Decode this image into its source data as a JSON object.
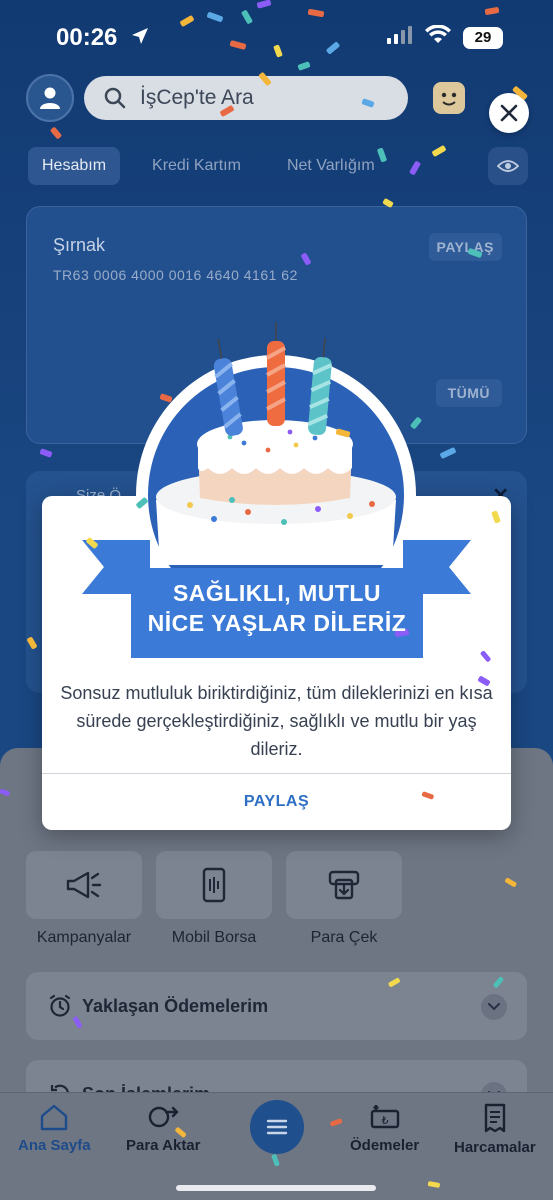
{
  "status": {
    "time": "00:26",
    "battery": "29"
  },
  "header": {
    "search_placeholder": "İşCep'te Ara"
  },
  "tabs": [
    {
      "label": "Hesabım",
      "active": true
    },
    {
      "label": "Kredi Kartım",
      "active": false
    },
    {
      "label": "Net Varlığım",
      "active": false
    }
  ],
  "account": {
    "name": "Şırnak",
    "iban": "TR63 0006 4000 0016 4640 4161 62",
    "share_label": "PAYLAŞ",
    "all_label": "TÜMÜ"
  },
  "second_card": {
    "title": "Size Ö..."
  },
  "quick_actions": [
    {
      "label": "Kampanyalar",
      "icon": "megaphone-icon"
    },
    {
      "label": "Mobil Borsa",
      "icon": "phone-chart-icon"
    },
    {
      "label": "Para Çek",
      "icon": "cash-withdraw-icon"
    }
  ],
  "rows": [
    {
      "label": "Yaklaşan Ödemelerim",
      "icon": "alarm-clock-icon"
    },
    {
      "label": "Son İşlemlerim",
      "icon": "history-icon"
    }
  ],
  "tab_bar": [
    {
      "label": "Ana Sayfa",
      "icon": "home-icon",
      "active": true
    },
    {
      "label": "Para Aktar",
      "icon": "transfer-icon",
      "active": false
    },
    {
      "label": "Ödemeler",
      "icon": "payment-icon",
      "active": false
    },
    {
      "label": "Harcamalar",
      "icon": "receipt-icon",
      "active": false
    }
  ],
  "modal": {
    "ribbon_line1": "SAĞLIKLI, MUTLU",
    "ribbon_line2": "NİCE YAŞLAR DİLERİZ",
    "message": "Sonsuz mutluluk biriktirdiğiniz, tüm dileklerinizi en kısa sürede gerçekleştirdiğiniz, sağlıklı ve mutlu bir yaş dileriz.",
    "share_label": "PAYLAŞ"
  },
  "colors": {
    "accent": "#2f6fc4",
    "ribbon": "#3b7ad6",
    "background": "#173f78",
    "confetti": [
      "#f4b63a",
      "#e86a45",
      "#5aa9e6",
      "#8b5cf6",
      "#f2d94e",
      "#4cc0b8"
    ]
  }
}
